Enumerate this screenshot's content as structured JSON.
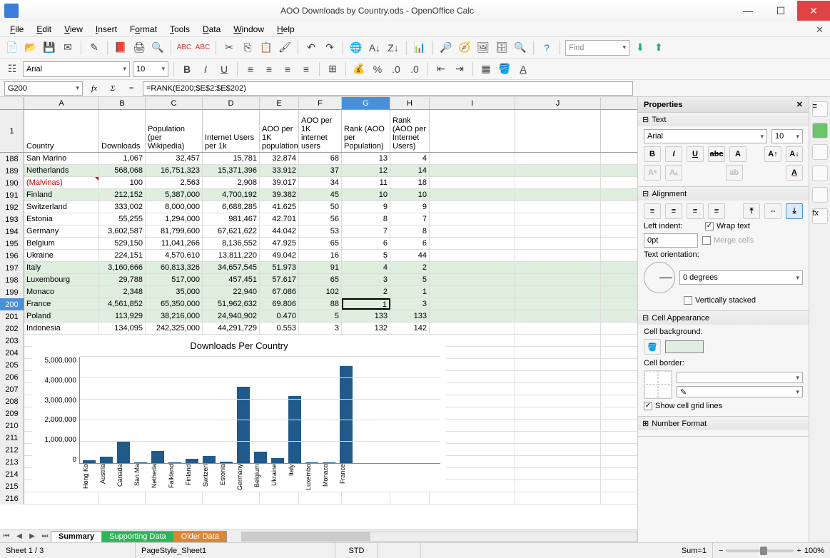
{
  "window": {
    "title": "AOO Downloads by Country.ods - OpenOffice Calc"
  },
  "menu": [
    "File",
    "Edit",
    "View",
    "Insert",
    "Format",
    "Tools",
    "Data",
    "Window",
    "Help"
  ],
  "toolbar2": {
    "font": "Arial",
    "size": "10"
  },
  "find_placeholder": "Find",
  "formula_bar": {
    "cell": "G200",
    "formula": "=RANK(E200;$E$2:$E$202)"
  },
  "columns": [
    "A",
    "B",
    "C",
    "D",
    "E",
    "F",
    "G",
    "H",
    "I",
    "J"
  ],
  "header_row": {
    "A": "Country",
    "B": "Downloads",
    "C": "Population (per Wikipedia)",
    "D": "Internet Users per 1k",
    "E": "AOO per 1K population",
    "F": "AOO per 1K internet users",
    "G": "Rank (AOO per Population)",
    "H": "Rank (AOO per Internet Users)"
  },
  "row_start": 188,
  "data_rows": [
    {
      "hl": false,
      "A": "San Marino",
      "B": "1,067",
      "C": "32,457",
      "D": "15,781",
      "E": "32.874",
      "F": "68",
      "G": "13",
      "H": "4"
    },
    {
      "hl": true,
      "A": "Netherlands",
      "B": "568,068",
      "C": "16,751,323",
      "D": "15,371,396",
      "E": "33.912",
      "F": "37",
      "G": "12",
      "H": "14"
    },
    {
      "hl": false,
      "A": "(Malvinas)",
      "red": true,
      "note": true,
      "B": "100",
      "C": "2,563",
      "D": "2,908",
      "E": "39.017",
      "F": "34",
      "G": "11",
      "H": "18"
    },
    {
      "hl": true,
      "A": "Finland",
      "B": "212,152",
      "C": "5,387,000",
      "D": "4,700,192",
      "E": "39.382",
      "F": "45",
      "G": "10",
      "H": "10"
    },
    {
      "hl": false,
      "A": "Switzerland",
      "B": "333,002",
      "C": "8,000,000",
      "D": "6,688,285",
      "E": "41.625",
      "F": "50",
      "G": "9",
      "H": "9"
    },
    {
      "hl": false,
      "A": "Estonia",
      "B": "55,255",
      "C": "1,294,000",
      "D": "981,467",
      "E": "42.701",
      "F": "56",
      "G": "8",
      "H": "7"
    },
    {
      "hl": false,
      "A": "Germany",
      "B": "3,602,587",
      "C": "81,799,600",
      "D": "67,621,622",
      "E": "44.042",
      "F": "53",
      "G": "7",
      "H": "8"
    },
    {
      "hl": false,
      "A": "Belgium",
      "B": "529,150",
      "C": "11,041,266",
      "D": "8,136,552",
      "E": "47.925",
      "F": "65",
      "G": "6",
      "H": "6"
    },
    {
      "hl": false,
      "A": "Ukraine",
      "B": "224,151",
      "C": "4,570,610",
      "D": "13,811,220",
      "E": "49.042",
      "F": "16",
      "G": "5",
      "H": "44"
    },
    {
      "hl": true,
      "A": "Italy",
      "B": "3,160,666",
      "C": "60,813,326",
      "D": "34,657,545",
      "E": "51.973",
      "F": "91",
      "G": "4",
      "H": "2"
    },
    {
      "hl": true,
      "A": "Luxembourg",
      "B": "29,788",
      "C": "517,000",
      "D": "457,451",
      "E": "57.617",
      "F": "65",
      "G": "3",
      "H": "5"
    },
    {
      "hl": true,
      "A": "Monaco",
      "B": "2,348",
      "C": "35,000",
      "D": "22,940",
      "E": "67.086",
      "F": "102",
      "G": "2",
      "H": "1"
    },
    {
      "hl": true,
      "A": "France",
      "sel": true,
      "B": "4,561,852",
      "C": "65,350,000",
      "D": "51,962,632",
      "E": "69.806",
      "F": "88",
      "G": "1",
      "H": "3"
    },
    {
      "hl": true,
      "A": "Poland",
      "B": "113,929",
      "C": "38,216,000",
      "D": "24,940,902",
      "E": "0.470",
      "F": "5",
      "G": "133",
      "H": "133"
    },
    {
      "hl": false,
      "A": "Indonesia",
      "B": "134,095",
      "C": "242,325,000",
      "D": "44,291,729",
      "E": "0.553",
      "F": "3",
      "G": "132",
      "H": "142"
    }
  ],
  "empty_rows": [
    203,
    204,
    205,
    206,
    207,
    208,
    209,
    210,
    211,
    212,
    213,
    214,
    215,
    216
  ],
  "chart_data": {
    "type": "bar",
    "title": "Downloads Per Country",
    "categories": [
      "Hong Ko",
      "Austria",
      "Canada",
      "San Ma",
      "Netherla",
      "Falkland",
      "Finland",
      "Switzerl",
      "Estonia",
      "Germany",
      "Belgium",
      "Ukraine",
      "Italy",
      "Luxembo",
      "Monaco",
      "France"
    ],
    "values": [
      150000,
      300000,
      1050000,
      1000,
      570000,
      100,
      210000,
      330000,
      55000,
      3600000,
      530000,
      220000,
      3160000,
      30000,
      2300,
      4560000
    ],
    "ylim": [
      0,
      5000000
    ],
    "yticks": [
      "5,000,000",
      "4,000,000",
      "3,000,000",
      "2,000,000",
      "1,000,000",
      "0"
    ]
  },
  "sheet_tabs": [
    "Summary",
    "Supporting Data",
    "Older Data"
  ],
  "statusbar": {
    "sheet": "Sheet 1 / 3",
    "style": "PageStyle_Sheet1",
    "mode": "STD",
    "sum": "Sum=1",
    "zoom": "100%"
  },
  "panel": {
    "title": "Properties",
    "text": {
      "title": "Text",
      "font": "Arial",
      "size": "10"
    },
    "alignment": {
      "title": "Alignment",
      "indent_label": "Left indent:",
      "indent": "0pt",
      "wrap": "Wrap text",
      "merge": "Merge cells",
      "orient_label": "Text orientation:",
      "orient": "0 degrees",
      "vstack": "Vertically stacked"
    },
    "appearance": {
      "title": "Cell Appearance",
      "bg_label": "Cell background:",
      "border_label": "Cell border:",
      "grid": "Show cell grid lines"
    },
    "number": {
      "title": "Number Format"
    }
  }
}
